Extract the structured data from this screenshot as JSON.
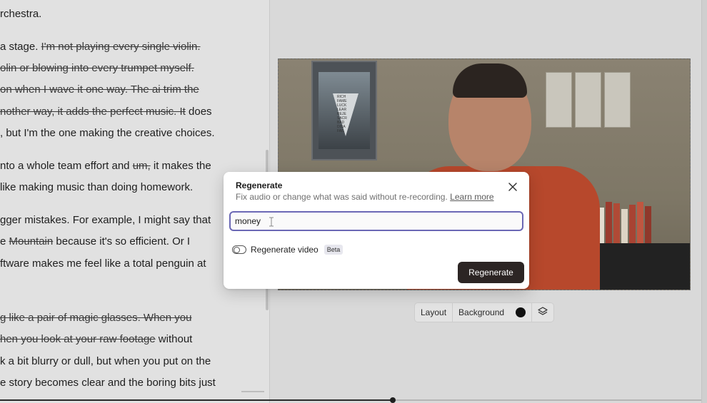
{
  "transcript": {
    "lines": [
      {
        "parts": [
          {
            "text": "rchestra.",
            "struck": false
          }
        ]
      },
      {
        "parts": [
          {
            "text": "a stage. ",
            "struck": false
          },
          {
            "text": "I'm not playing every single violin.",
            "struck": true
          }
        ]
      },
      {
        "parts": [
          {
            "text": "olin or blowing into every trumpet myself.",
            "struck": true
          }
        ]
      },
      {
        "parts": [
          {
            "text": "on when I wave it one way. The ai trim the",
            "struck": true
          }
        ]
      },
      {
        "parts": [
          {
            "text": "nother way, it adds the perfect music. It",
            "struck": true
          },
          {
            "text": " does",
            "struck": false
          }
        ]
      },
      {
        "parts": [
          {
            "text": ", but I'm the one making the creative choices.",
            "struck": false
          }
        ]
      },
      {
        "parts": [
          {
            "text": "nto a whole team effort and ",
            "struck": false
          },
          {
            "text": "um,",
            "struck": true
          },
          {
            "text": " it makes the",
            "struck": false
          }
        ]
      },
      {
        "parts": [
          {
            "text": " like making music than doing homework.",
            "struck": false
          }
        ]
      },
      {
        "parts": [
          {
            "text": "gger mistakes. For example, I might say that",
            "struck": false
          }
        ]
      },
      {
        "parts": [
          {
            "text": "e ",
            "struck": false
          },
          {
            "text": "Mountain",
            "struck": true
          },
          {
            "text": " because it's so efficient. Or I",
            "struck": false
          }
        ]
      },
      {
        "parts": [
          {
            "text": "ftware makes me feel like a total penguin at",
            "struck": false
          }
        ]
      },
      {
        "parts": [
          {
            "text": "g like a pair of magic glasses. When you",
            "struck": true
          }
        ]
      },
      {
        "parts": [
          {
            "text": "hen you look at your raw footage",
            "struck": true
          },
          {
            "text": " without",
            "struck": false
          }
        ]
      },
      {
        "parts": [
          {
            "text": "k a bit blurry or dull, but when you put on the",
            "struck": false
          }
        ]
      },
      {
        "parts": [
          {
            "text": "e story becomes clear and the boring bits just",
            "struck": false
          }
        ]
      }
    ]
  },
  "poster": {
    "words": [
      "RICH",
      "FAME",
      "LUCK",
      "LEAR",
      "REJE",
      "SACR",
      "BAD",
      "DISA",
      "FAIL"
    ]
  },
  "video_toolbar": {
    "layout_label": "Layout",
    "background_label": "Background",
    "background_color": "#111111",
    "layers_icon": "layers-icon"
  },
  "timeline": {
    "progress_percent": 56
  },
  "modal": {
    "title": "Regenerate",
    "subtitle": "Fix audio or change what was said without re-recording.",
    "learn_more": "Learn more",
    "input_value": "money",
    "toggle_label": "Regenerate video",
    "toggle_on": false,
    "beta_label": "Beta",
    "submit_label": "Regenerate",
    "close_icon": "close-icon"
  },
  "colors": {
    "accent_focus": "#6b68b5",
    "primary_button": "#2c2524"
  }
}
